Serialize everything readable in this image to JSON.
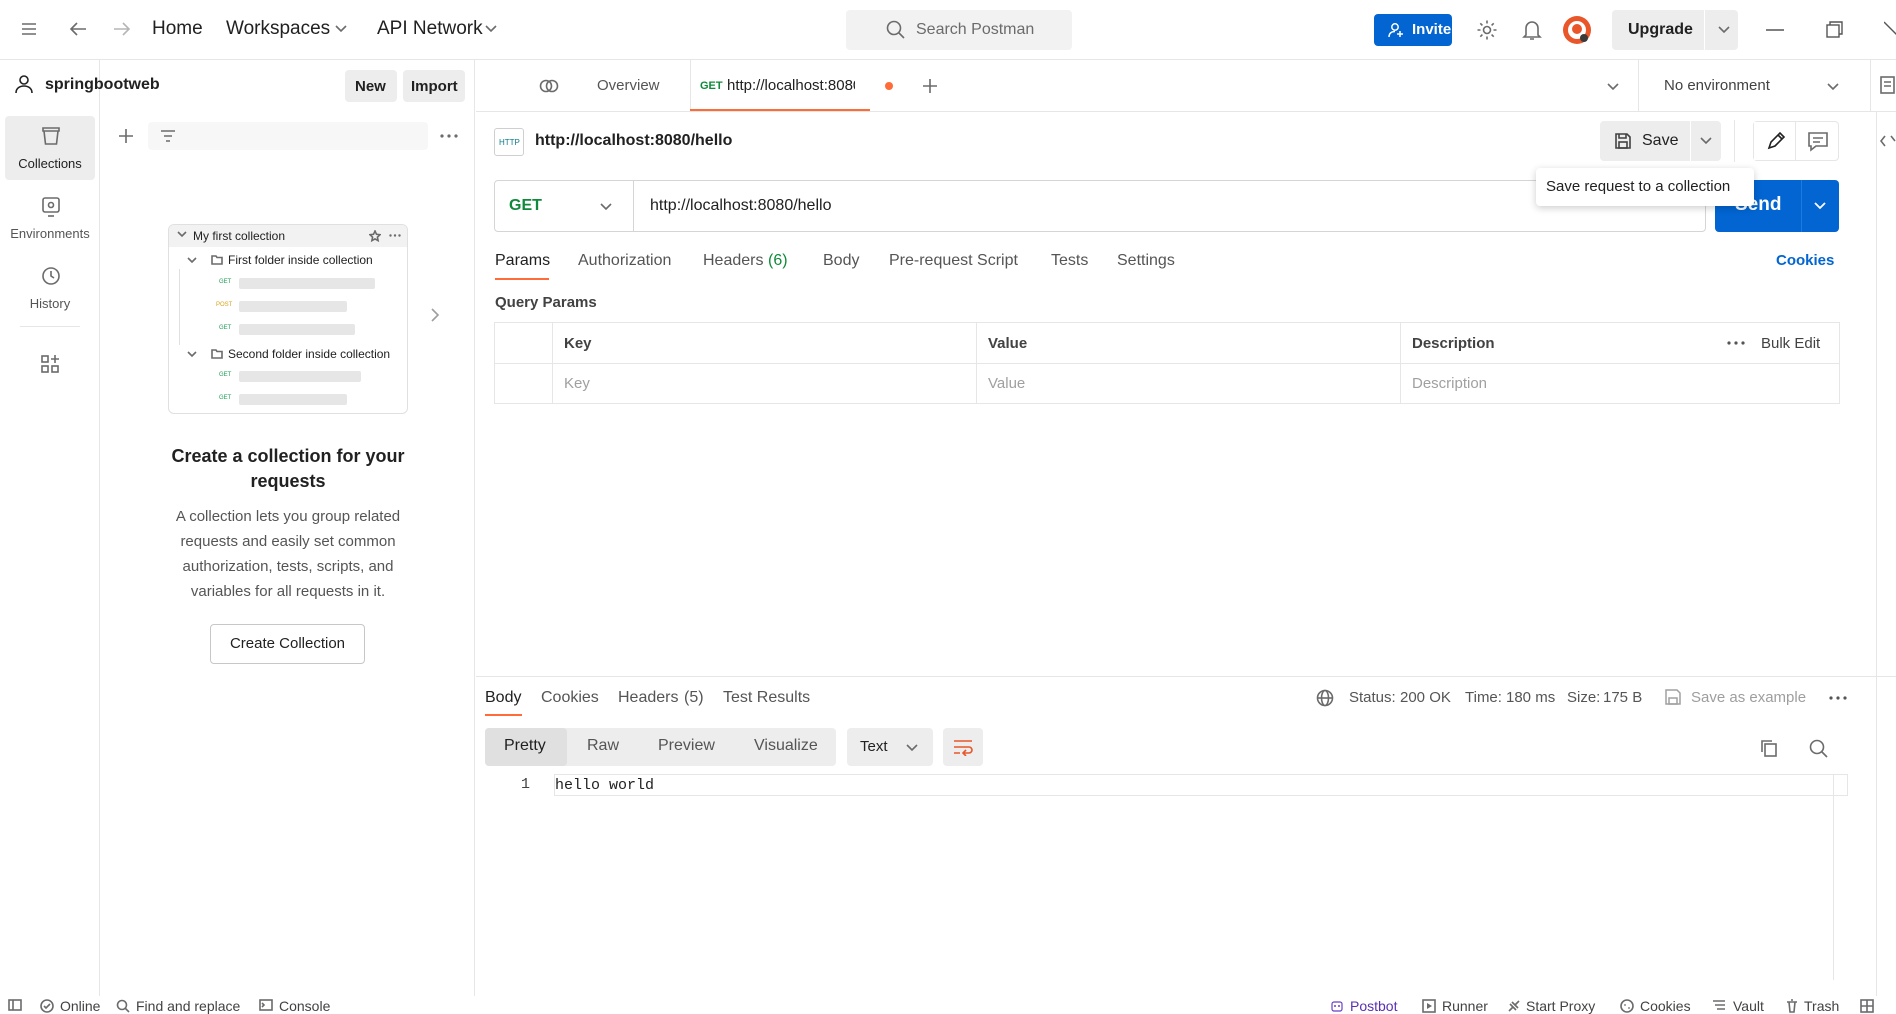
{
  "topbar": {
    "home": "Home",
    "workspaces": "Workspaces",
    "api_network": "API Network",
    "search_placeholder": "Search Postman",
    "invite": "Invite",
    "upgrade": "Upgrade"
  },
  "workspace": {
    "name": "springbootweb",
    "new": "New",
    "import": "Import"
  },
  "rail": [
    {
      "label": "Collections",
      "icon": "collections-icon"
    },
    {
      "label": "Environments",
      "icon": "environments-icon"
    },
    {
      "label": "History",
      "icon": "history-icon"
    }
  ],
  "empty_state": {
    "illustration": {
      "collection": "My first collection",
      "folder1": "First folder inside collection",
      "folder2": "Second folder inside collection",
      "methods": [
        "GET",
        "POST",
        "GET",
        "GET",
        "GET"
      ]
    },
    "title": "Create a collection for your requests",
    "description": "A collection lets you group related requests and easily set common authorization, tests, scripts, and variables for all requests in it.",
    "button": "Create Collection"
  },
  "tabs": {
    "overview": "Overview",
    "active_method": "GET",
    "active_label": "http://localhost:8080/hello",
    "environment": "No environment"
  },
  "request": {
    "title": "http://localhost:8080/hello",
    "save": "Save",
    "tooltip": "Save request to a collection",
    "method": "GET",
    "url": "http://localhost:8080/hello",
    "send": "Send",
    "tabs": [
      "Params",
      "Authorization",
      "Headers",
      "Body",
      "Pre-request Script",
      "Tests",
      "Settings"
    ],
    "headers_count": "(6)",
    "cookies": "Cookies",
    "query_params_title": "Query Params",
    "columns": [
      "Key",
      "Value",
      "Description"
    ],
    "bulk_edit": "Bulk Edit",
    "placeholders": [
      "Key",
      "Value",
      "Description"
    ]
  },
  "response": {
    "tabs": [
      "Body",
      "Cookies",
      "Headers",
      "Test Results"
    ],
    "headers_count": "(5)",
    "status_label": "Status:",
    "status": "200 OK",
    "time_label": "Time:",
    "time": "180 ms",
    "size_label": "Size:",
    "size": "175 B",
    "save_example": "Save as example",
    "views": [
      "Pretty",
      "Raw",
      "Preview",
      "Visualize"
    ],
    "format": "Text",
    "line_number": "1",
    "body": "hello world"
  },
  "statusbar": {
    "online": "Online",
    "find_replace": "Find and replace",
    "console": "Console",
    "postbot": "Postbot",
    "runner": "Runner",
    "start_proxy": "Start Proxy",
    "cookies": "Cookies",
    "vault": "Vault",
    "trash": "Trash"
  },
  "colors": {
    "accent": "#0265d2",
    "success": "#0f8a3a",
    "tab_indicator": "#ff6c37"
  }
}
